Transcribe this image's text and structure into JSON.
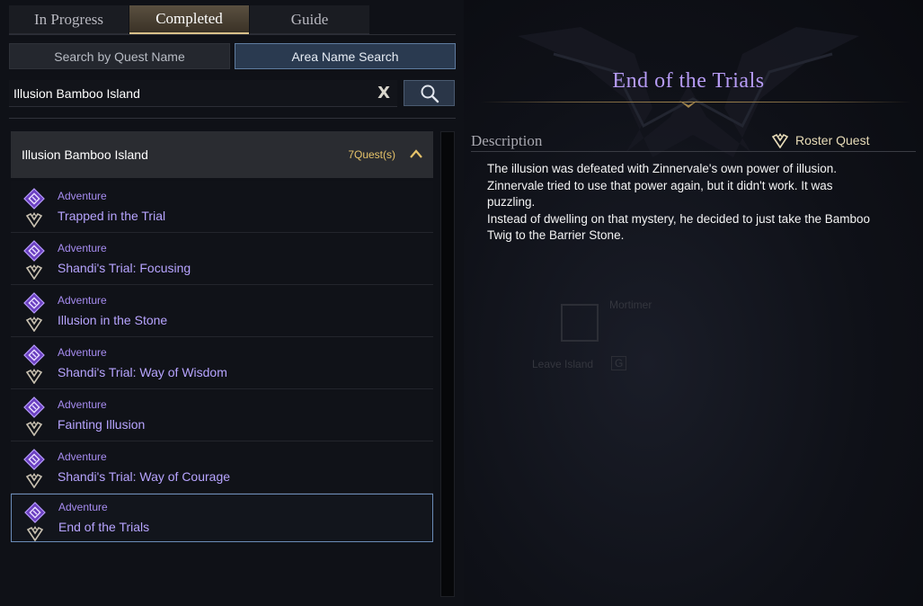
{
  "tabs": [
    {
      "label": "In Progress"
    },
    {
      "label": "Completed"
    },
    {
      "label": "Guide"
    }
  ],
  "active_tab": "Completed",
  "search_modes": [
    {
      "label": "Search by Quest Name"
    },
    {
      "label": "Area Name Search"
    }
  ],
  "active_search_mode": "Area Name Search",
  "search": {
    "value": "Illusion Bamboo Island",
    "clear_label": "X"
  },
  "group": {
    "name": "Illusion Bamboo Island",
    "count": "7Quest(s)",
    "chevron": "^"
  },
  "quests": [
    {
      "category": "Adventure",
      "name": "Trapped in the Trial"
    },
    {
      "category": "Adventure",
      "name": "Shandi's Trial: Focusing"
    },
    {
      "category": "Adventure",
      "name": "Illusion in the Stone"
    },
    {
      "category": "Adventure",
      "name": "Shandi's Trial: Way of Wisdom"
    },
    {
      "category": "Adventure",
      "name": "Fainting Illusion"
    },
    {
      "category": "Adventure",
      "name": "Shandi's Trial: Way of Courage"
    },
    {
      "category": "Adventure",
      "name": "End of the Trials"
    }
  ],
  "selected_quest": "End of the Trials",
  "detail": {
    "title": "End of the Trials",
    "description_label": "Description",
    "tag": "Roster Quest",
    "description": "The illusion was defeated with Zinnervale's own power of illusion. Zinnervale tried to use that power again, but it didn't work. It was puzzling.\nInstead of dwelling on that mystery, he decided to just take the Bamboo Twig to the Barrier Stone."
  },
  "background_text": {
    "npc": "Mortimer",
    "exit": "Leave Island",
    "key": "G"
  },
  "colors": {
    "accent_gold": "#e6c36a",
    "quest_name": "#b7a4ff",
    "title": "#b79cf6",
    "selected_border": "#6b8cb8"
  }
}
